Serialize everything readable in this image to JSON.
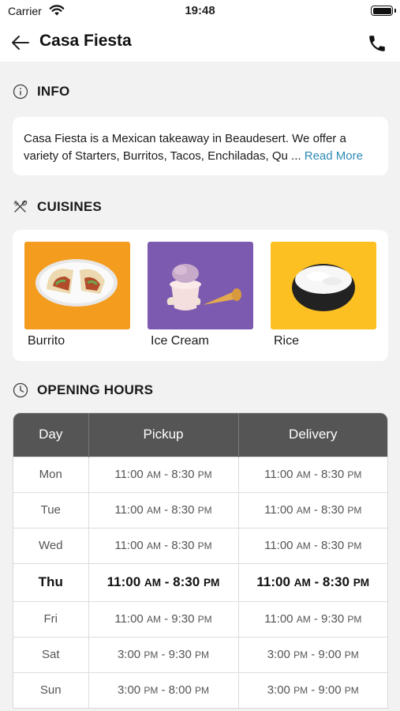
{
  "status_bar": {
    "carrier": "Carrier",
    "time": "19:48"
  },
  "nav": {
    "title": "Casa Fiesta"
  },
  "info": {
    "heading": "INFO",
    "line1": "Casa Fiesta is a Mexican takeaway in Beaudesert. We offer a",
    "line2": "variety of Starters, Burritos, Tacos, Enchiladas, Qu",
    "ellipsis": "...",
    "read_more": "Read More"
  },
  "cuisines": {
    "heading": "CUISINES",
    "items": [
      {
        "label": "Burrito",
        "bg": "#f39c1e"
      },
      {
        "label": "Ice Cream",
        "bg": "#7b5ab0"
      },
      {
        "label": "Rice",
        "bg": "#fcc022"
      }
    ]
  },
  "opening_hours": {
    "heading": "OPENING HOURS",
    "columns": [
      "Day",
      "Pickup",
      "Delivery"
    ],
    "today": "Thu",
    "rows": [
      {
        "day": "Mon",
        "pickup": "11:00 AM - 8:30 PM",
        "delivery": "11:00 AM - 8:30 PM"
      },
      {
        "day": "Tue",
        "pickup": "11:00 AM - 8:30 PM",
        "delivery": "11:00 AM - 8:30 PM"
      },
      {
        "day": "Wed",
        "pickup": "11:00 AM - 8:30 PM",
        "delivery": "11:00 AM - 8:30 PM"
      },
      {
        "day": "Thu",
        "pickup": "11:00 AM - 8:30 PM",
        "delivery": "11:00 AM - 8:30 PM"
      },
      {
        "day": "Fri",
        "pickup": "11:00 AM - 9:30 PM",
        "delivery": "11:00 AM - 9:30 PM"
      },
      {
        "day": "Sat",
        "pickup": "3:00 PM - 9:30 PM",
        "delivery": "3:00 PM - 9:00 PM"
      },
      {
        "day": "Sun",
        "pickup": "3:00 PM - 8:00 PM",
        "delivery": "3:00 PM - 9:00 PM"
      }
    ]
  }
}
